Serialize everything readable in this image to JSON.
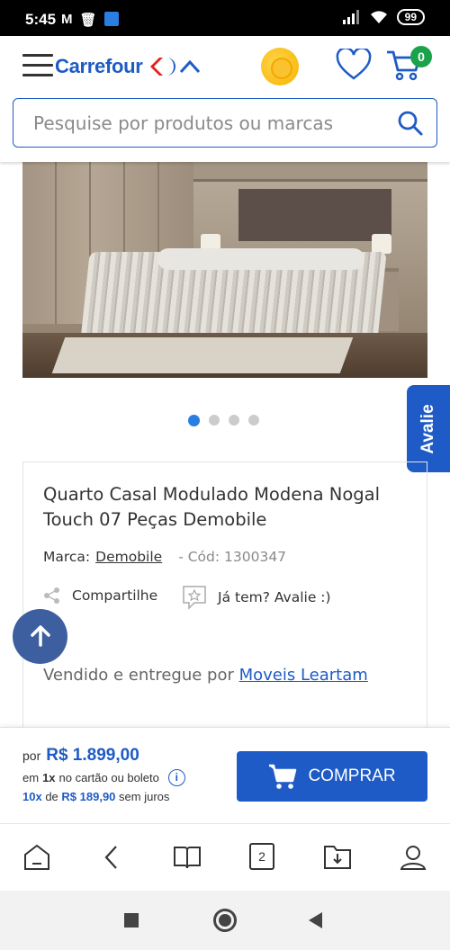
{
  "status_bar": {
    "time": "5:45",
    "battery": "99",
    "notif_m": "M"
  },
  "header": {
    "logo_text": "Carrefour",
    "cart_count": "0",
    "search_placeholder": "Pesquise por produtos ou marcas",
    "accent_color": "#1e5bc6"
  },
  "gallery": {
    "total_images": 4,
    "active_index": 0
  },
  "avalie_tab": "Avalie",
  "product": {
    "title": "Quarto Casal Modulado Modena Nogal Touch 07 Peças Demobile",
    "brand_label": "Marca:",
    "brand": "Demobile",
    "code": "- Cód: 1300347",
    "share_label": "Compartilhe",
    "review_label": "Já tem? Avalie :)",
    "seller_prefix": "Vendido e entregue por ",
    "seller": "Moveis Leartam"
  },
  "buy_bar": {
    "price_prefix": "por",
    "price": "R$ 1.899,00",
    "install_em": "em",
    "install_count": "1x",
    "install_text": "no cartão ou boleto",
    "parcels": "10x",
    "parcels_de": "de",
    "parcel_value": "R$ 189,90",
    "parcels_suffix": "sem juros",
    "buy_label": "COMPRAR"
  },
  "browser_nav": {
    "tab_count": "2"
  }
}
